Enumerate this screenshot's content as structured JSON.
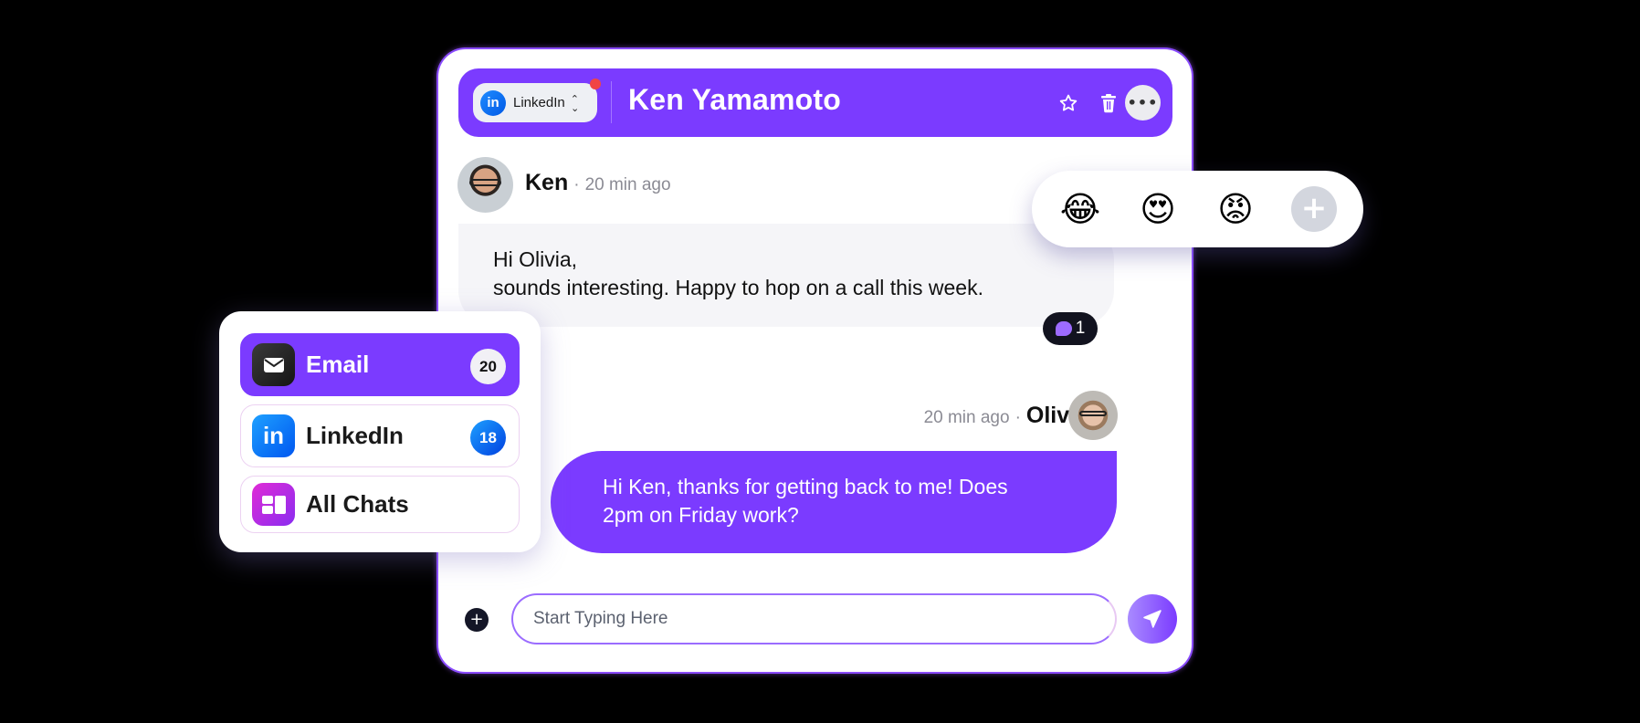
{
  "colors": {
    "accent": "#7b3bff",
    "background": "#000000",
    "notification": "#f04545",
    "linkedin": "#0a66ff"
  },
  "header": {
    "channel_selector": {
      "label": "LinkedIn",
      "icon": "linkedin-icon",
      "has_notification": true
    },
    "contact_name": "Ken Yamamoto",
    "actions": [
      {
        "name": "favorite",
        "icon": "star-icon"
      },
      {
        "name": "delete",
        "icon": "trash-icon"
      },
      {
        "name": "more",
        "icon": "more-horizontal-icon",
        "glyph": "•••"
      }
    ]
  },
  "messages": [
    {
      "sender": "Ken",
      "separator": "·",
      "time": "20 min ago",
      "lines": [
        "Hi Olivia,",
        "sounds interesting. Happy to hop on a call this week."
      ],
      "reply_count": "1"
    },
    {
      "sender": "Olivia",
      "separator": "·",
      "time": "20 min ago",
      "lines": [
        "Hi Ken, thanks for getting back to me! Does",
        "2pm on Friday work?"
      ]
    }
  ],
  "reactions": {
    "items": [
      {
        "name": "tears-of-joy",
        "glyph": "😂"
      },
      {
        "name": "heart-eyes",
        "glyph": "😍"
      },
      {
        "name": "angry",
        "glyph": "😡"
      }
    ],
    "add_glyph": "+"
  },
  "composer": {
    "add_glyph": "+",
    "placeholder": "Start Typing Here",
    "value": ""
  },
  "channels": [
    {
      "label": "Email",
      "count": "20",
      "icon": "mail-icon",
      "active": true
    },
    {
      "label": "LinkedIn",
      "count": "18",
      "icon": "linkedin-icon",
      "active": false
    },
    {
      "label": "All Chats",
      "count": null,
      "icon": "grid-icon",
      "active": false
    }
  ]
}
